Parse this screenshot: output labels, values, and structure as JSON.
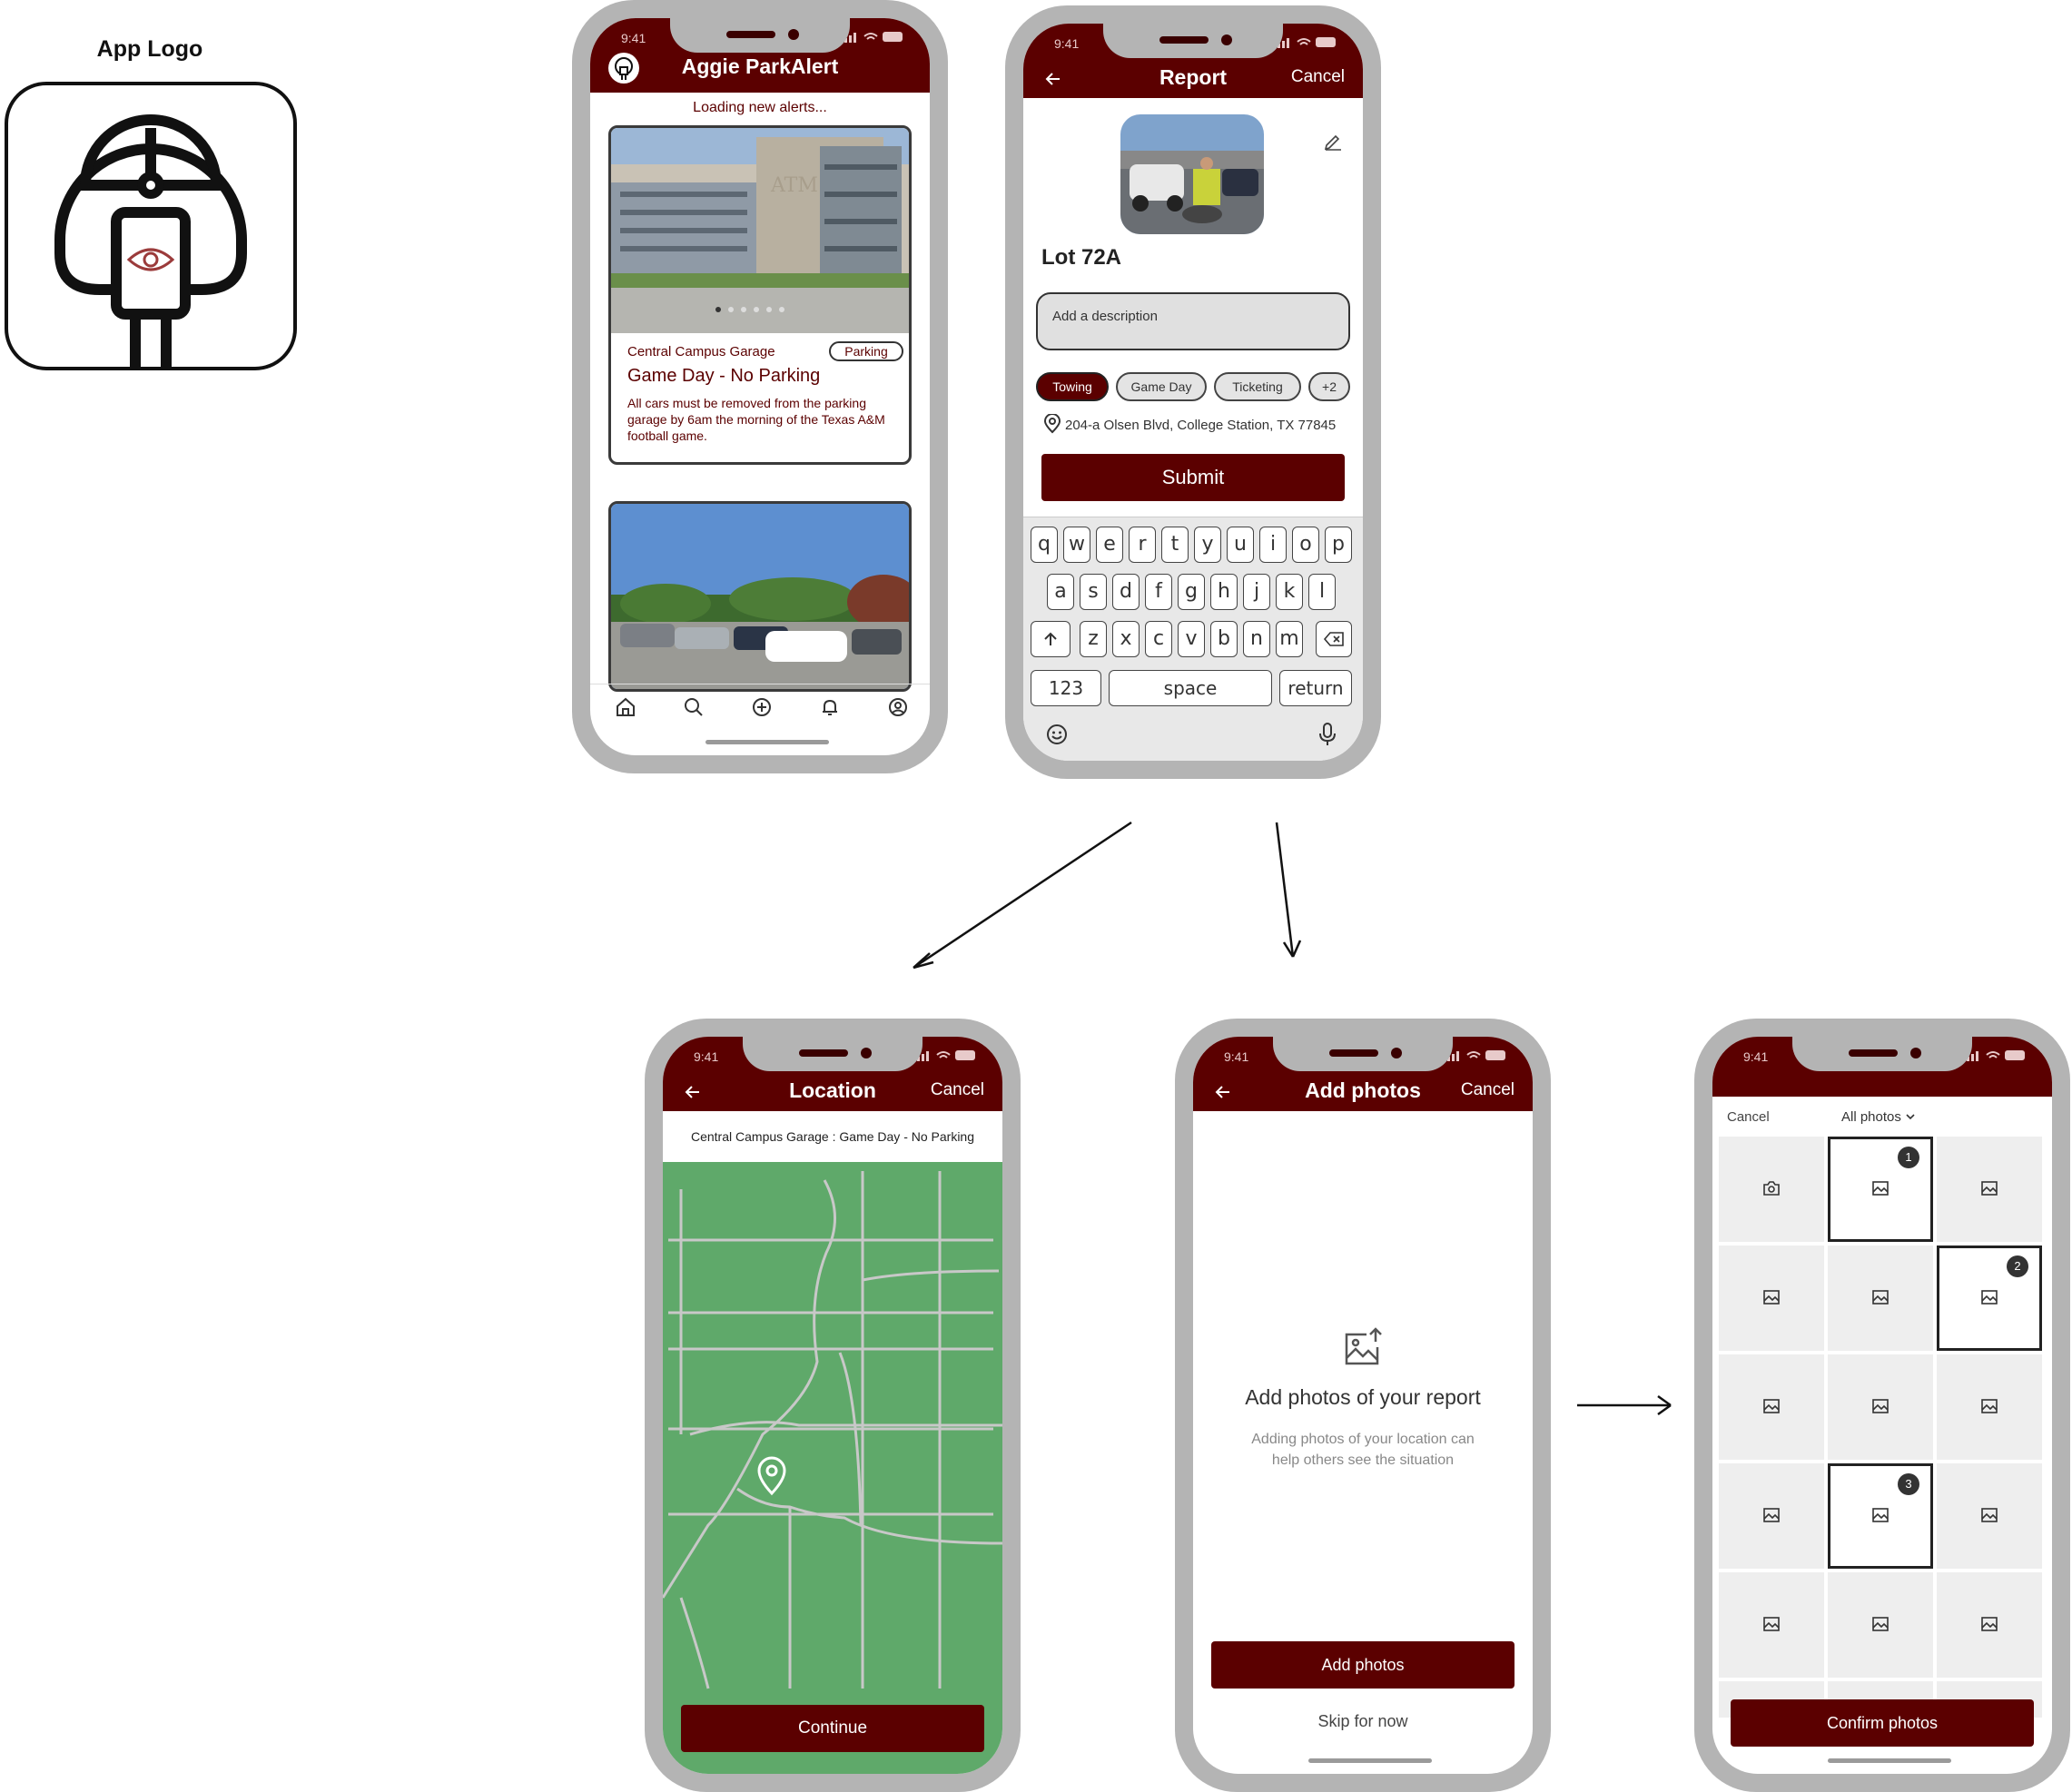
{
  "logo": {
    "title": "App Logo"
  },
  "status": {
    "time_feed": "9:41",
    "time_other": "9:41"
  },
  "feed": {
    "title": "Aggie ParkAlert",
    "loading": "Loading new alerts...",
    "card1": {
      "location": "Central Campus Garage",
      "tag": "Parking",
      "headline": "Game Day - No Parking",
      "body": "All cars must be removed from the parking garage by 6am the morning of the Texas A&M football game.",
      "building_mark": "ATM"
    },
    "tabs": [
      "home-icon",
      "search-icon",
      "add-circle-icon",
      "bell-icon",
      "user-circle-icon"
    ]
  },
  "report": {
    "title": "Report",
    "cancel": "Cancel",
    "lot": "Lot 72A",
    "description_placeholder": "Add a description",
    "tags": [
      "Towing",
      "Game Day",
      "Ticketing",
      "+2"
    ],
    "address": "204-a Olsen Blvd, College Station, TX 77845",
    "submit": "Submit",
    "keyboard": {
      "row1": [
        "q",
        "w",
        "e",
        "r",
        "t",
        "y",
        "u",
        "i",
        "o",
        "p"
      ],
      "row2": [
        "a",
        "s",
        "d",
        "f",
        "g",
        "h",
        "j",
        "k",
        "l"
      ],
      "row3": [
        "z",
        "x",
        "c",
        "v",
        "b",
        "n",
        "m"
      ],
      "num": "123",
      "space": "space",
      "return": "return"
    }
  },
  "location": {
    "title": "Location",
    "cancel": "Cancel",
    "subtitle": "Central Campus Garage : Game Day  - No Parking",
    "continue": "Continue",
    "map_color": "#5fa96a"
  },
  "add_photos": {
    "title": "Add photos",
    "cancel": "Cancel",
    "heading": "Add photos of your report",
    "text": "Adding photos of your location can help others see the situation",
    "add_button": "Add photos",
    "skip": "Skip for now"
  },
  "picker": {
    "cancel": "Cancel",
    "album": "All photos",
    "confirm": "Confirm photos",
    "badges": [
      "1",
      "2",
      "3"
    ]
  },
  "colors": {
    "maroon": "#5b0000",
    "map_green": "#5fa96a",
    "phone_frame": "#b4b4b4"
  }
}
